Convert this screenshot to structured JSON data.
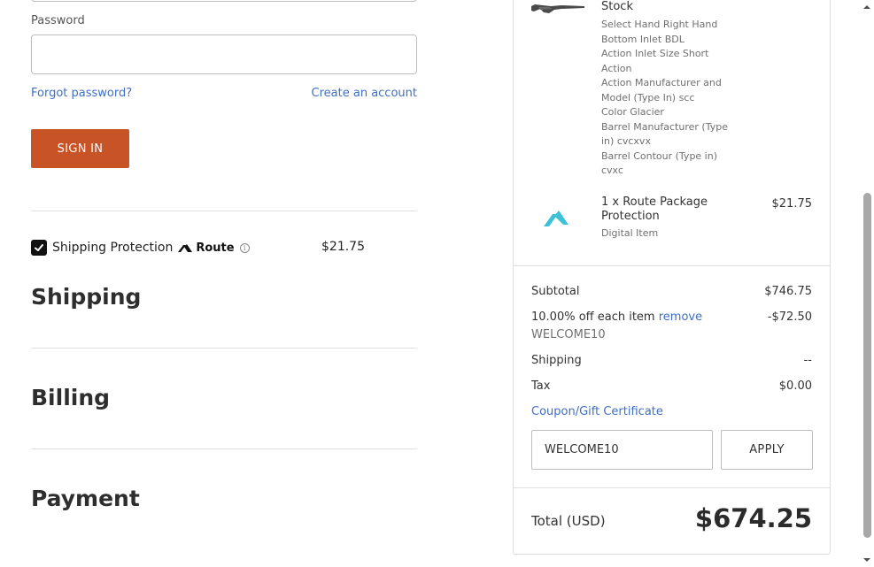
{
  "login": {
    "password_label": "Password",
    "password_value": "",
    "forgot_password": "Forgot password?",
    "create_account": "Create an account",
    "sign_in": "SIGN IN"
  },
  "shipping_protection": {
    "checked": true,
    "label": "Shipping Protection",
    "brand": "Route",
    "info_icon": "info-icon",
    "price": "$21.75"
  },
  "sections": {
    "shipping": "Shipping",
    "billing": "Billing",
    "payment": "Payment"
  },
  "order_summary": {
    "items": [
      {
        "name": "Stock",
        "thumbnail": "rifle-stock-icon",
        "options": [
          "Select Hand Right Hand",
          "Bottom Inlet BDL",
          "Action Inlet Size Short Action",
          "Action Manufacturer and Model (Type In) scc",
          "Color Glacier",
          "Barrel Manufacturer (Type in) cvcxvx",
          "Barrel Contour (Type in) cvxc"
        ]
      },
      {
        "name": "1 x Route Package Protection",
        "sub": "Digital Item",
        "price": "$21.75",
        "thumbnail": "route-package-icon"
      }
    ],
    "subtotal_label": "Subtotal",
    "subtotal_value": "$746.75",
    "discount_label": "10.00% off each item",
    "discount_remove": "remove",
    "discount_code": "WELCOME10",
    "discount_value": "-$72.50",
    "shipping_label": "Shipping",
    "shipping_value": "--",
    "tax_label": "Tax",
    "tax_value": "$0.00",
    "coupon_link": "Coupon/Gift Certificate",
    "coupon_value": "WELCOME10",
    "apply_label": "APPLY",
    "total_label": "Total (USD)",
    "total_value": "$674.25"
  },
  "colors": {
    "accent": "#c75327",
    "link": "#3f6fc3",
    "route_teal": "#3cc1d6"
  }
}
